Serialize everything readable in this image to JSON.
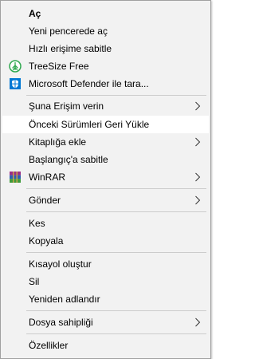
{
  "menu": {
    "open": "Aç",
    "open_new_window": "Yeni pencerede aç",
    "pin_quick_access": "Hızlı erişime sabitle",
    "treesize": "TreeSize Free",
    "defender": "Microsoft Defender ile tara...",
    "give_access": "Şuna Erişim verin",
    "restore_previous": "Önceki Sürümleri Geri Yükle",
    "include_library": "Kitaplığa ekle",
    "pin_start": "Başlangıç'a sabitle",
    "winrar": "WinRAR",
    "send_to": "Gönder",
    "cut": "Kes",
    "copy": "Kopyala",
    "create_shortcut": "Kısayol oluştur",
    "delete": "Sil",
    "rename": "Yeniden adlandır",
    "ownership": "Dosya sahipliği",
    "properties": "Özellikler"
  },
  "icons": {
    "treesize": "treesize-icon",
    "defender": "defender-shield-icon",
    "winrar": "winrar-icon",
    "submenu": "chevron-right-icon"
  },
  "colors": {
    "menu_background": "#f2f2f2",
    "hover_background": "#ffffff",
    "separator": "#cccccc",
    "treesize_green": "#2fa84f",
    "defender_blue": "#0078d4"
  }
}
